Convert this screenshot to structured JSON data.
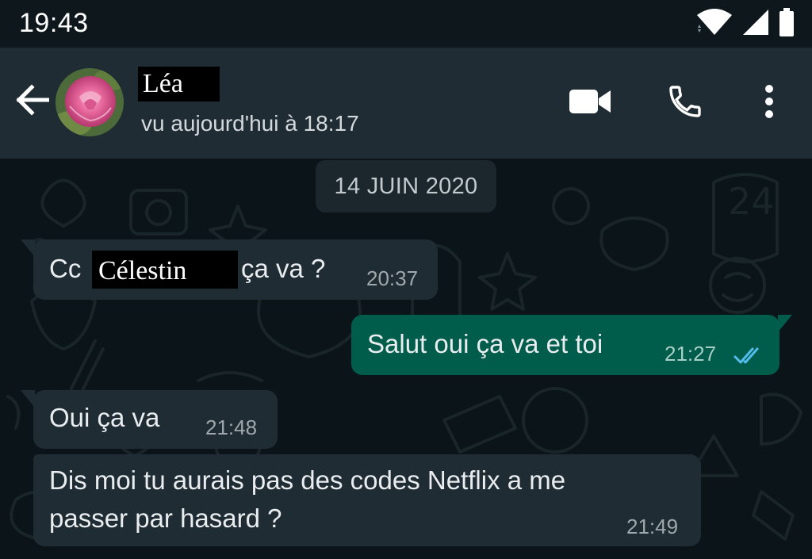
{
  "status_bar": {
    "time": "19:43",
    "icons": [
      "wifi-icon",
      "signal-icon",
      "battery-icon"
    ]
  },
  "header": {
    "contact_name": "Léa",
    "last_seen": "vu aujourd'hui à 18:17",
    "actions": [
      "video-call-icon",
      "voice-call-icon",
      "more-options-icon"
    ]
  },
  "chat": {
    "date_separator": "14 JUIN 2020",
    "messages": [
      {
        "direction": "incoming",
        "text_before": "Cc",
        "redacted_name": "Célestin",
        "text_after": "ça va ?",
        "time": "20:37"
      },
      {
        "direction": "outgoing",
        "text": "Salut oui ça va et toi",
        "time": "21:27",
        "read_receipt": "double-check-read-icon"
      },
      {
        "direction": "incoming",
        "text": "Oui ça va",
        "time": "21:48"
      },
      {
        "direction": "incoming",
        "lines": [
          "Dis moi tu aurais pas des codes Netflix a me",
          "passer par hasard ?"
        ],
        "time": "21:49"
      }
    ]
  },
  "colors": {
    "header_bg": "#1f2c33",
    "chat_bg": "#0b1418",
    "incoming_bubble": "#1f2c33",
    "outgoing_bubble": "#005c4b",
    "read_tick": "#53bdeb"
  }
}
